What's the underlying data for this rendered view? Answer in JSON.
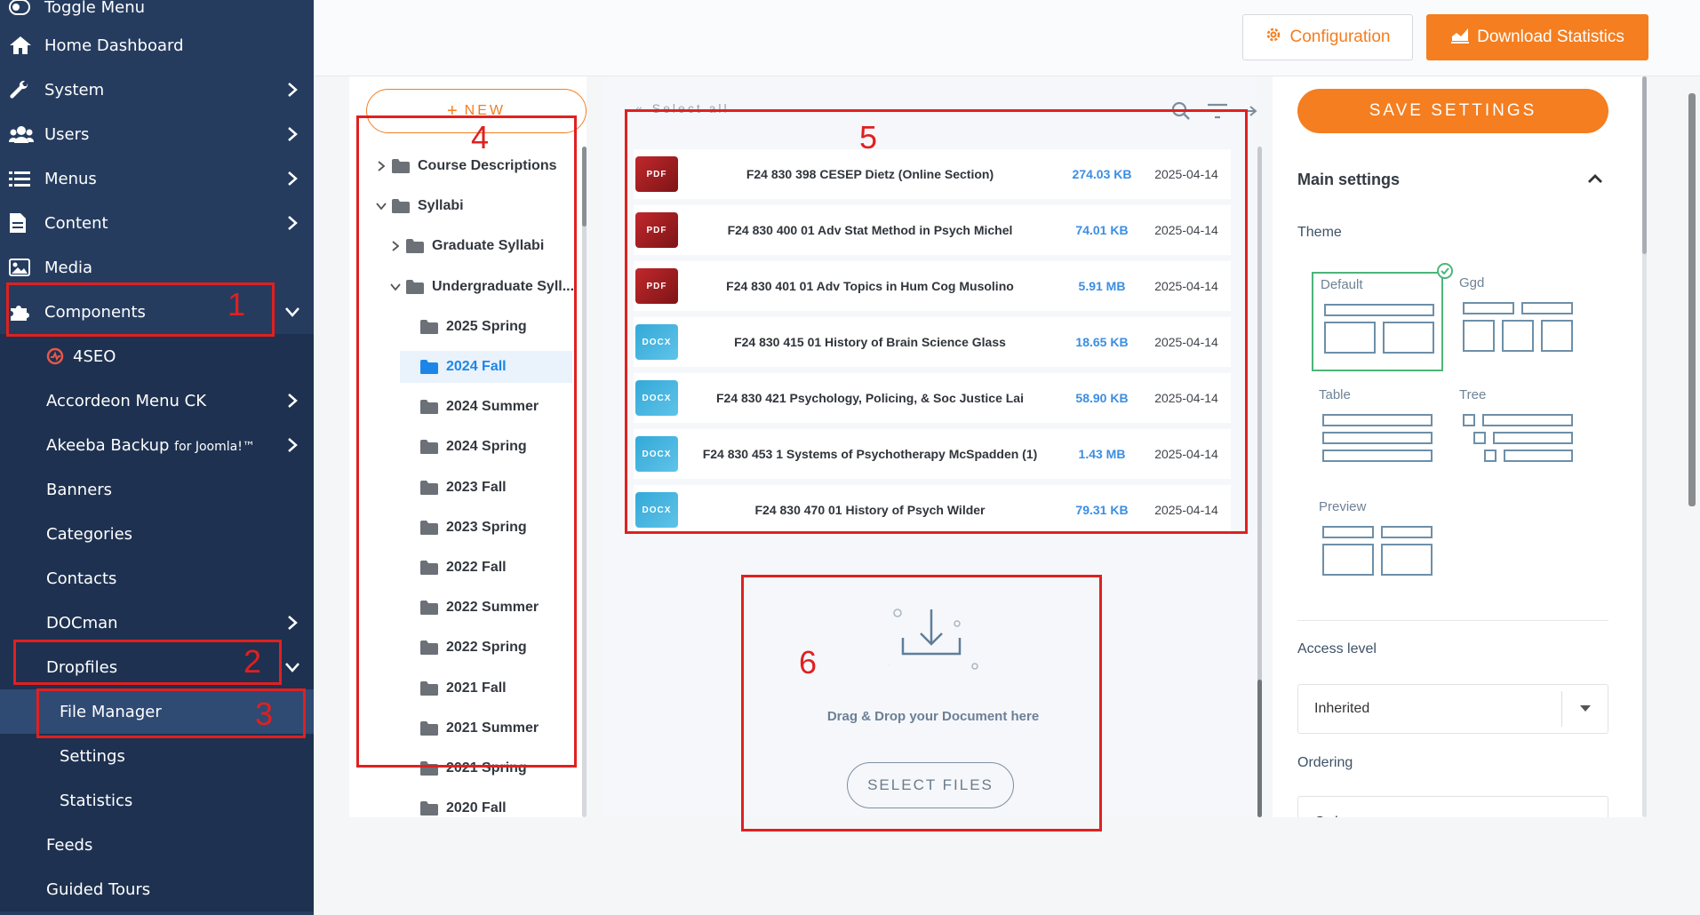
{
  "sidebar": {
    "toggle": "Toggle Menu",
    "items": [
      {
        "label": "Home Dashboard"
      },
      {
        "label": "System"
      },
      {
        "label": "Users"
      },
      {
        "label": "Menus"
      },
      {
        "label": "Content"
      },
      {
        "label": "Media"
      },
      {
        "label": "Components"
      }
    ],
    "components": [
      {
        "label": "4SEO"
      },
      {
        "label": "Accordeon Menu CK"
      },
      {
        "label": "Akeeba Backup",
        "suffix": "for Joomla!™"
      },
      {
        "label": "Banners"
      },
      {
        "label": "Categories"
      },
      {
        "label": "Contacts"
      },
      {
        "label": "DOCman"
      },
      {
        "label": "Dropfiles"
      }
    ],
    "dropfiles": [
      {
        "label": "File Manager"
      },
      {
        "label": "Settings"
      },
      {
        "label": "Statistics"
      }
    ],
    "after": [
      {
        "label": "Feeds"
      },
      {
        "label": "Guided Tours"
      }
    ]
  },
  "toolbar": {
    "config_label": "Configuration",
    "download_label": "Download Statistics"
  },
  "tree": {
    "new_label": "NEW",
    "items": [
      {
        "label": "Course Descriptions"
      },
      {
        "label": "Syllabi"
      },
      {
        "label": "Graduate Syllabi"
      },
      {
        "label": "Undergraduate Syll..."
      },
      {
        "label": "2025 Spring"
      },
      {
        "label": "2024 Fall"
      },
      {
        "label": "2024 Summer"
      },
      {
        "label": "2024 Spring"
      },
      {
        "label": "2023 Fall"
      },
      {
        "label": "2023 Spring"
      },
      {
        "label": "2022 Fall"
      },
      {
        "label": "2022 Summer"
      },
      {
        "label": "2022 Spring"
      },
      {
        "label": "2021 Fall"
      },
      {
        "label": "2021 Summer"
      },
      {
        "label": "2021 Spring"
      },
      {
        "label": "2020 Fall"
      }
    ]
  },
  "files": {
    "select_all": "Select all",
    "rows": [
      {
        "type": "PDF",
        "name": "F24 830 398 CESEP Dietz (Online Section)",
        "size": "274.03 KB",
        "date": "2025-04-14"
      },
      {
        "type": "PDF",
        "name": "F24 830 400 01 Adv Stat Method in Psych Michel",
        "size": "74.01 KB",
        "date": "2025-04-14"
      },
      {
        "type": "PDF",
        "name": "F24 830 401 01 Adv Topics in Hum Cog Musolino",
        "size": "5.91 MB",
        "date": "2025-04-14"
      },
      {
        "type": "DOCX",
        "name": "F24 830 415 01 History of Brain Science Glass",
        "size": "18.65 KB",
        "date": "2025-04-14"
      },
      {
        "type": "DOCX",
        "name": "F24 830 421 Psychology, Policing, & Soc Justice Lai",
        "size": "58.90 KB",
        "date": "2025-04-14"
      },
      {
        "type": "DOCX",
        "name": "F24 830 453 1 Systems of Psychotherapy McSpadden (1)",
        "size": "1.43 MB",
        "date": "2025-04-14"
      },
      {
        "type": "DOCX",
        "name": "F24 830 470 01 History of Psych Wilder",
        "size": "79.31 KB",
        "date": "2025-04-14"
      }
    ],
    "drop_text": "Drag & Drop your Document here",
    "select_files": "SELECT FILES"
  },
  "settings": {
    "save_label": "SAVE SETTINGS",
    "section_title": "Main settings",
    "theme_label": "Theme",
    "themes": [
      {
        "label": "Default"
      },
      {
        "label": "Ggd"
      },
      {
        "label": "Table"
      },
      {
        "label": "Tree"
      },
      {
        "label": "Preview"
      }
    ],
    "access_label": "Access level",
    "access_value": "Inherited",
    "ordering_label": "Ordering",
    "ordering_value": "Ord..."
  },
  "annotations": [
    "1",
    "2",
    "3",
    "4",
    "5",
    "6"
  ],
  "colors": {
    "sidebar": "#253c5f",
    "accent": "#f47e20",
    "link": "#1c86e8",
    "annotation": "#e02020"
  }
}
